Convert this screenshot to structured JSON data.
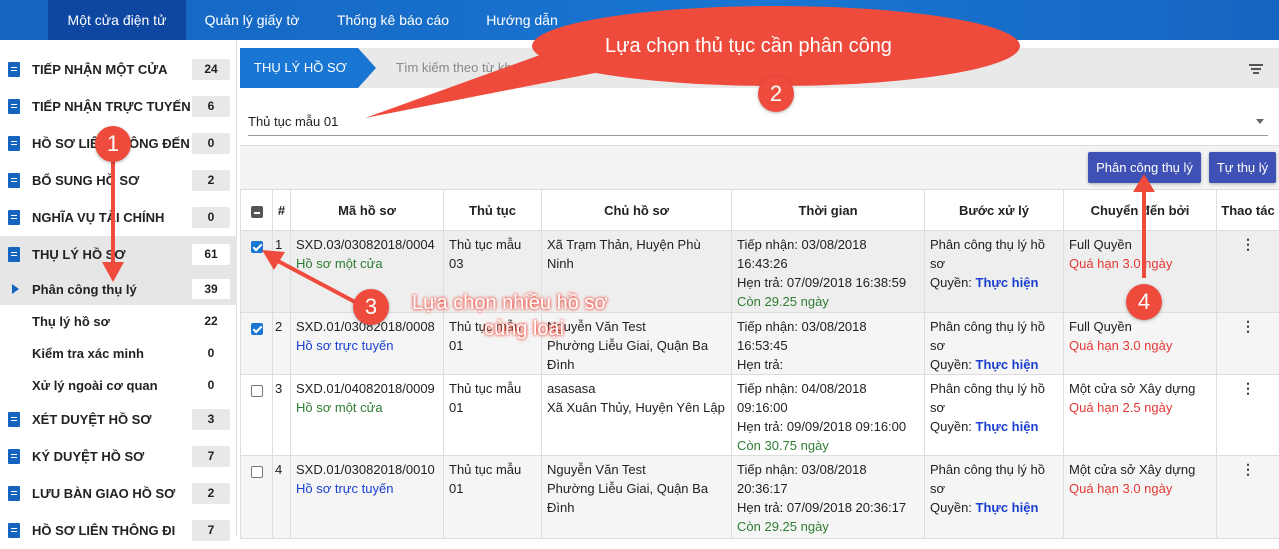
{
  "nav": [
    "Một cửa điện tử",
    "Quản lý giấy tờ",
    "Thống kê báo cáo",
    "Hướng dẫn"
  ],
  "sidebar": {
    "items": [
      {
        "label": "TIẾP NHẬN MỘT CỬA",
        "count": "24"
      },
      {
        "label": "TIẾP NHẬN TRỰC TUYẾN",
        "count": "6"
      },
      {
        "label": "HỒ SƠ LIÊN THÔNG ĐẾN",
        "count": "0"
      },
      {
        "label": "BỔ SUNG HỒ SƠ",
        "count": "2"
      },
      {
        "label": "NGHĨA VỤ TÀI CHÍNH",
        "count": "0"
      },
      {
        "label": "THỤ LÝ HỒ SƠ",
        "count": "61"
      }
    ],
    "subitems": [
      {
        "label": "Phân công thụ lý",
        "count": "39"
      },
      {
        "label": "Thụ lý hồ sơ",
        "count": "22"
      },
      {
        "label": "Kiểm tra xác minh",
        "count": "0"
      },
      {
        "label": "Xử lý ngoài cơ quan",
        "count": "0"
      }
    ],
    "items2": [
      {
        "label": "XÉT DUYỆT HỒ SƠ",
        "count": "3"
      },
      {
        "label": "KÝ DUYỆT HỒ SƠ",
        "count": "7"
      },
      {
        "label": "LƯU BÀN GIAO HỒ SƠ",
        "count": "2"
      },
      {
        "label": "HỒ SƠ LIÊN THÔNG ĐI",
        "count": "7"
      }
    ]
  },
  "breadcrumb": "THỤ LÝ HỒ SƠ",
  "search_placeholder": "Tìm kiếm theo từ khoá ...",
  "procedure_select": "Thủ tục mẫu 01",
  "buttons": {
    "assign": "Phân công thụ lý",
    "self": "Tự thụ lý"
  },
  "table": {
    "headers": [
      "#",
      "Mã hồ sơ",
      "Thủ tục",
      "Chủ hồ sơ",
      "Thời gian",
      "Bước xử lý",
      "Chuyển đến bởi",
      "Thao tác"
    ],
    "rows": [
      {
        "num": "1",
        "code": "SXD.03/03082018/0004",
        "source": "Hồ sơ một cửa",
        "proc": [
          "Thủ tục mẫu",
          "03"
        ],
        "owner": [
          "Xã Trạm Thản, Huyện Phù Ninh"
        ],
        "t1": "Tiếp nhận: 03/08/2018",
        "t2": "16:43:26",
        "t3": "Hẹn trả: 07/09/2018 16:38:59",
        "t4": "Còn 29.25 ngày",
        "step": [
          "Phân công thụ lý hồ",
          "sơ"
        ],
        "perm": "Quyền:",
        "permact": "Thực hiện",
        "by": "Full Quyền",
        "late": "Quá hạn 3.0 ngày",
        "checked": true
      },
      {
        "num": "2",
        "code": "SXD.01/03082018/0008",
        "source": "Hồ sơ trực tuyến",
        "proc": [
          "Thủ tục mẫu",
          "01"
        ],
        "owner": [
          "Nguyễn Văn Test",
          "Phường Liễu Giai, Quận Ba",
          "Đình"
        ],
        "t1": "Tiếp nhận: 03/08/2018",
        "t2": "16:53:45",
        "t3": "Hẹn trả:",
        "t4": "",
        "step": [
          "Phân công thụ lý hồ",
          "sơ"
        ],
        "perm": "Quyền:",
        "permact": "Thực hiện",
        "by": "Full Quyền",
        "late": "Quá hạn 3.0 ngày",
        "checked": true
      },
      {
        "num": "3",
        "code": "SXD.01/04082018/0009",
        "source": "Hồ sơ một cửa",
        "proc": [
          "Thủ tục mẫu",
          "01"
        ],
        "owner": [
          "asasasa",
          "Xã Xuân Thủy, Huyện Yên Lập"
        ],
        "t1": "Tiếp nhận: 04/08/2018",
        "t2": "09:16:00",
        "t3": "Hẹn trả: 09/09/2018 09:16:00",
        "t4": "Còn 30.75 ngày",
        "step": [
          "Phân công thụ lý hồ",
          "sơ"
        ],
        "perm": "Quyền:",
        "permact": "Thực hiện",
        "by": "Một cửa sở Xây dựng",
        "late": "Quá hạn 2.5 ngày",
        "checked": false
      },
      {
        "num": "4",
        "code": "SXD.01/03082018/0010",
        "source": "Hồ sơ trực tuyến",
        "proc": [
          "Thủ tục mẫu",
          "01"
        ],
        "owner": [
          "Nguyễn Văn Test",
          "Phường Liễu Giai, Quận Ba",
          "Đình"
        ],
        "t1": "Tiếp nhận: 03/08/2018",
        "t2": "20:36:17",
        "t3": "Hẹn trả: 07/09/2018 20:36:17",
        "t4": "Còn 29.25 ngày",
        "step": [
          "Phân công thụ lý hồ",
          "sơ"
        ],
        "perm": "Quyền:",
        "permact": "Thực hiện",
        "by": "Một cửa sở Xây dựng",
        "late": "Quá hạn 3.0 ngày",
        "checked": false
      }
    ]
  },
  "annotations": {
    "c1": "1",
    "c2": "2",
    "c3": "3",
    "c4": "4",
    "t2": "Lựa chọn thủ tục cần phân công",
    "t3a": "Lựa chọn nhiều hồ sơ",
    "t3b": "cùng loại"
  },
  "colors": {
    "primary": "#1976d2",
    "callout": "#ef4b3c",
    "late": "#e53935"
  }
}
